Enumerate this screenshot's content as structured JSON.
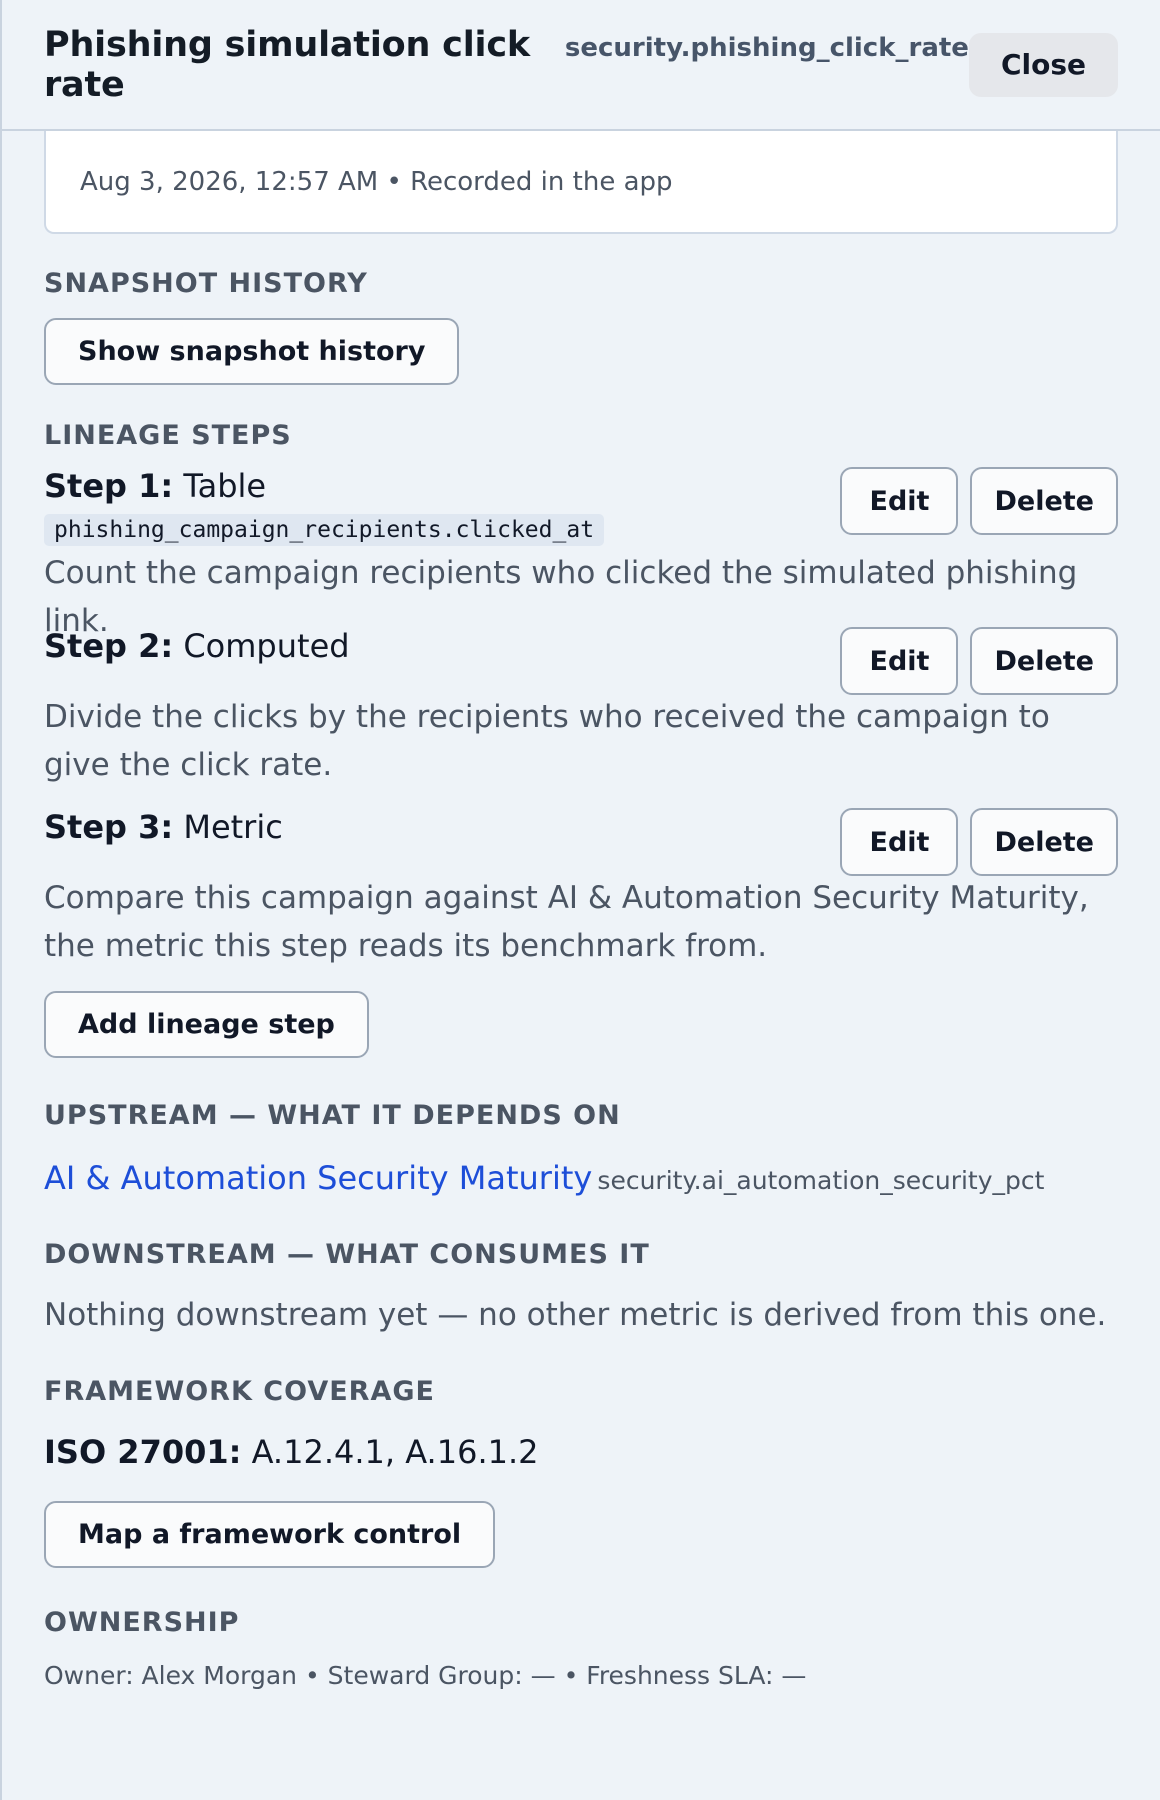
{
  "header": {
    "title": "Phishing simulation click rate",
    "metric_key": "security.phishing_click_rate",
    "close_label": "Close"
  },
  "record": {
    "text": "Aug 3, 2026, 12:57 AM • Recorded in the app"
  },
  "snapshot": {
    "title": "SNAPSHOT HISTORY",
    "button": "Show snapshot history"
  },
  "lineage": {
    "title": "LINEAGE STEPS",
    "steps": [
      {
        "label": "Step 1:",
        "type": "Table",
        "code": "phishing_campaign_recipients.clicked_at",
        "description": "Count the campaign recipients who clicked the simulated phishing link.",
        "edit": "Edit",
        "delete": "Delete"
      },
      {
        "label": "Step 2:",
        "type": "Computed",
        "description": "Divide the clicks by the recipients who received the campaign to give the click rate.",
        "edit": "Edit",
        "delete": "Delete"
      },
      {
        "label": "Step 3:",
        "type": "Metric",
        "description": "Compare this campaign against AI & Automation Security Maturity, the metric this step reads its benchmark from.",
        "edit": "Edit",
        "delete": "Delete"
      }
    ],
    "add_button": "Add lineage step"
  },
  "upstream": {
    "title": "UPSTREAM — WHAT IT DEPENDS ON",
    "link": "AI & Automation Security Maturity",
    "key": "security.ai_automation_security_pct"
  },
  "downstream": {
    "title": "DOWNSTREAM — WHAT CONSUMES IT",
    "text": "Nothing downstream yet — no other metric is derived from this one."
  },
  "framework": {
    "title": "FRAMEWORK COVERAGE",
    "label": "ISO 27001:",
    "controls": "A.12.4.1, A.16.1.2",
    "button": "Map a framework control"
  },
  "ownership": {
    "title": "OWNERSHIP",
    "text": "Owner: Alex Morgan • Steward Group: — • Freshness SLA: —"
  }
}
